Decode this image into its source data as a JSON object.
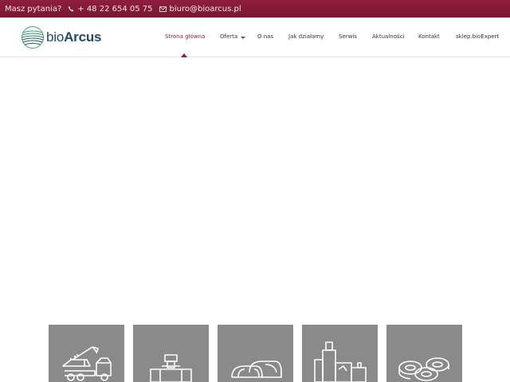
{
  "topbar": {
    "question": "Masz pytania?",
    "phone": "+ 48 22 654 05 75",
    "email": "biuro@bioarcus.pl",
    "icons": [
      "phone-icon",
      "envelope-icon"
    ]
  },
  "brand": {
    "name_prefix": "bio",
    "name_suffix": "Arcus",
    "primary_color": "#8e1e3b",
    "logo_color": "#1f4b6d",
    "logo_accent": "#3aa57a"
  },
  "nav": {
    "items": [
      {
        "label": "Strona główna",
        "active": true
      },
      {
        "label": "Oferta",
        "active": false,
        "has_dropdown": true
      },
      {
        "label": "O nas",
        "active": false
      },
      {
        "label": "Jak działamy",
        "active": false
      },
      {
        "label": "Serwis",
        "active": false
      },
      {
        "label": "Aktualności",
        "active": false
      },
      {
        "label": "Kontakt",
        "active": false
      },
      {
        "label": "sklep.bioExpert",
        "active": false
      }
    ]
  },
  "tiles": [
    {
      "icon": "dump-truck-icon"
    },
    {
      "icon": "pipe-valve-icon"
    },
    {
      "icon": "silage-mounds-icon"
    },
    {
      "icon": "factory-icon"
    },
    {
      "icon": "bale-wraps-icon"
    }
  ]
}
